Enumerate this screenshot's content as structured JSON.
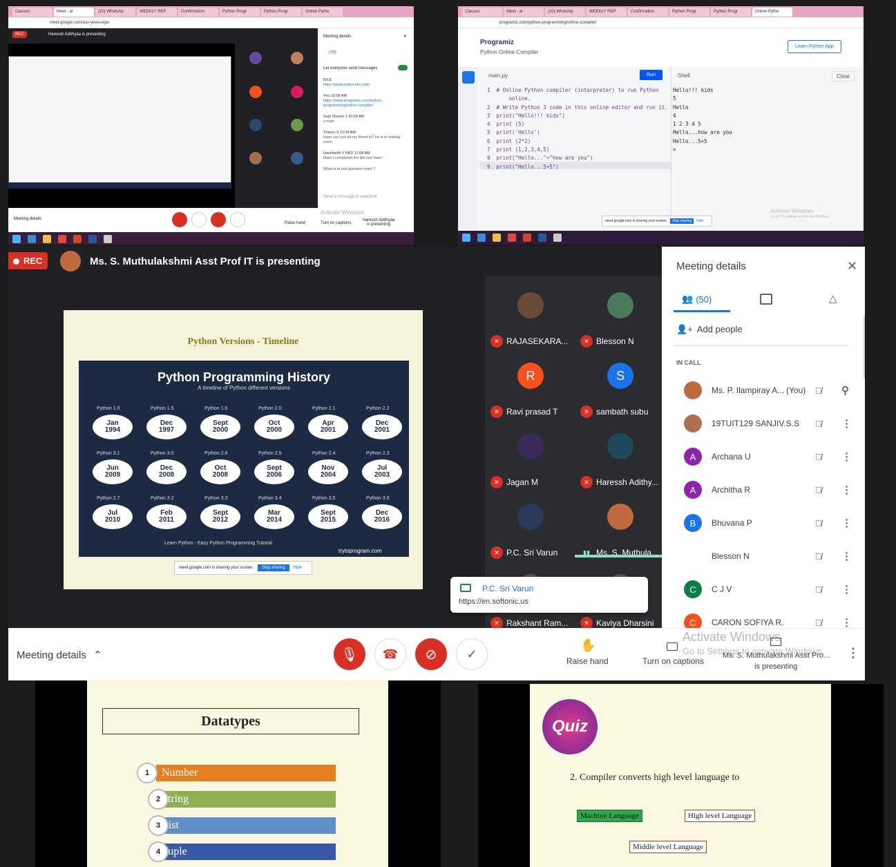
{
  "q1": {
    "tabs": [
      "Classes",
      "Meet - ai",
      "(20) WhatsAp",
      "WEEKLY REP",
      "Confirmation",
      "Python Progr",
      "Python Progr",
      "Online Pytho"
    ],
    "url": "meet.google.com/asv-yewo-egw",
    "rec": "REC",
    "presenting": "Haressh Adithyaa is presenting",
    "panel_title": "Meeting details",
    "people_count": "(49)",
    "toggle_text": "Let everyone send messages",
    "chat": [
      {
        "who": "IDLE",
        "text": "https://www.online-ide.com/"
      },
      {
        "who": "You 10:58 AM",
        "text": "https://www.programiz.com/python-programming/online-compiler/"
      },
      {
        "who": "Supi Sharon J 10:58 AM",
        "text": "s mam"
      },
      {
        "who": "Tharun S 11:04 AM",
        "text": "mam can you let my friend in? he is in waiting room"
      },
      {
        "who": "Harshanth V KKD 11:08 AM",
        "text": "Mam I completed the 8th one mam"
      },
      {
        "who": "",
        "text": "What is te last question mam ?"
      }
    ],
    "send_placeholder": "Send a message to everyone",
    "bottom_left": "Meeting details",
    "raise_hand": "Raise hand",
    "captions": "Turn on captions",
    "presenter": "Haressh Adithyaa is presenting",
    "watermark": "Activate Windows",
    "watermark2": "Go to settings to activate Windows"
  },
  "q2": {
    "tabs": [
      "Classes",
      "Meet - ai",
      "(20) WhatsAp",
      "WEEKLY REP",
      "Confirmation",
      "Python Progr",
      "Python Progr",
      "Online Pytho"
    ],
    "url": "programiz.com/python-programming/online-compiler/",
    "brand": "Programiz",
    "subtitle": "Python Online Compiler",
    "learn_button": "Learn Python App",
    "file": "main.py",
    "run": "Run",
    "shell": "Shell",
    "clear": "Clear",
    "code": [
      "1  # Online Python compiler (interpreter) to run Python",
      "       online.",
      "2  # Write Python 3 code in this online editor and run it.",
      "3  print(\"Hello!!! kids\")",
      "4  print (5)",
      "5  print('Hello')",
      "6  print (2*2)",
      "7  print (1,2,3,4,5)",
      "8  print(\"Hello...\"+\"how are you\")",
      "9  print(\"Hello...5+5\")"
    ],
    "output": [
      "Hello!!! kids",
      "5",
      "Hello",
      "4",
      "1 2 3 4 5",
      "Hello...how are you",
      "Hello...5+5",
      ">"
    ],
    "share_text": "meet.google.com is sharing your screen.",
    "stop_sharing": "Stop sharing",
    "hide": "Hide",
    "watermark": "Activate Windows",
    "watermark2": "Go to PC settings to activate Windows."
  },
  "main": {
    "rec": "REC",
    "presenting": "Ms. S. Muthulakshmi Asst Prof IT is presenting",
    "slide": {
      "heading": "Python Versions - Timeline",
      "title": "Python Programming History",
      "subtitle": "A timeline of Python different versions",
      "rows": [
        [
          [
            "Python 1.0",
            "Jan",
            "1994"
          ],
          [
            "Python 1.5",
            "Dec",
            "1997"
          ],
          [
            "Python 1.6",
            "Sept",
            "2000"
          ],
          [
            "Python 2.0",
            "Oct",
            "2000"
          ],
          [
            "Python 2.1",
            "Apr",
            "2001"
          ],
          [
            "Python 2.2",
            "Dec",
            "2001"
          ]
        ],
        [
          [
            "Python 3.1",
            "Jun",
            "2009"
          ],
          [
            "Python 3.0",
            "Dec",
            "2008"
          ],
          [
            "Python 2.6",
            "Oct",
            "2008"
          ],
          [
            "Python 2.5",
            "Sept",
            "2006"
          ],
          [
            "Python 2.4",
            "Nov",
            "2004"
          ],
          [
            "Python 2.3",
            "Jul",
            "2003"
          ]
        ],
        [
          [
            "Python 2.7",
            "Jul",
            "2010"
          ],
          [
            "Python 3.2",
            "Feb",
            "2011"
          ],
          [
            "Python 3.3",
            "Sept",
            "2012"
          ],
          [
            "Python 3.4",
            "Mar",
            "2014"
          ],
          [
            "Python 3.5",
            "Sept",
            "2015"
          ],
          [
            "Python 3.6",
            "Dec",
            "2016"
          ]
        ]
      ],
      "footer": "Learn Python - Easy Python Programming Tutorial",
      "site": "trytoprogram.com",
      "share_text": "meet.google.com is sharing your screen.",
      "stop_sharing": "Stop sharing",
      "hide": "Hide"
    },
    "tiles": [
      {
        "name": "RAJASEKARA...",
        "initial": "",
        "color": "#6b4a3a"
      },
      {
        "name": "Blesson N",
        "initial": "",
        "color": "#4a7a5a"
      },
      {
        "name": "Ravi prasad T",
        "initial": "R",
        "color": "#f4511e"
      },
      {
        "name": "sambath subu",
        "initial": "S",
        "color": "#1a73e8"
      },
      {
        "name": "Jagan M",
        "initial": "",
        "color": "#3a2a5a"
      },
      {
        "name": "Haressh Adithy...",
        "initial": "",
        "color": "#1e4a5a"
      },
      {
        "name": "P.C. Sri Varun",
        "initial": "",
        "color": "#2a3a5a"
      },
      {
        "name": "Ms. S. Muthula...",
        "initial": "",
        "color": "#c06a40"
      },
      {
        "name": "Rakshant Ram...",
        "initial": "",
        "color": "#555"
      },
      {
        "name": "Kaviya Dharsini",
        "initial": "",
        "color": "#555"
      }
    ],
    "chat_popup": {
      "who": "P.C. Sri Varun",
      "text": "https://en.softonic.us"
    },
    "panel": {
      "title": "Meeting details",
      "people_count": "(50)",
      "add_people": "Add people",
      "in_call": "IN CALL",
      "people": [
        {
          "name": "Ms. P. Ilampiray A...",
          "you": "(You)",
          "initial": "",
          "color": "#c06a40"
        },
        {
          "name": "19TUIT129 SANJIV.S.S",
          "you": "",
          "initial": "",
          "color": "#b07050"
        },
        {
          "name": "Archana U",
          "you": "",
          "initial": "A",
          "color": "#8e24aa"
        },
        {
          "name": "Architha R",
          "you": "",
          "initial": "A",
          "color": "#8e24aa"
        },
        {
          "name": "Bhuvana P",
          "you": "",
          "initial": "B",
          "color": "#1a73e8"
        },
        {
          "name": "Blesson N",
          "you": "",
          "initial": "",
          "color": "transparent"
        },
        {
          "name": "C J V",
          "you": "",
          "initial": "C",
          "color": "#0b8043"
        },
        {
          "name": "CARON SOFIYA R.",
          "you": "",
          "initial": "C",
          "color": "#f4511e"
        }
      ]
    },
    "bottom": {
      "meeting_details": "Meeting details",
      "raise_hand": "Raise hand",
      "captions": "Turn on captions",
      "presenter": "Ms. S. Muthulakshmi Asst Pro...",
      "presenter2": "is presenting",
      "watermark": "Activate Windows",
      "watermark2": "Go to Settings to activate Windows."
    }
  },
  "q3": {
    "title": "Datatypes",
    "items": [
      "Number",
      "String",
      "List",
      "Tuple"
    ],
    "nums": [
      "1",
      "2",
      "3",
      "4"
    ],
    "colors": [
      "#e67e22",
      "#8fb050",
      "#5d8fc8",
      "#3a5aa8"
    ]
  },
  "q4": {
    "logo": "Quiz",
    "question": "2. Compiler converts high level language to",
    "options": [
      "Machine Language",
      "High level Language",
      "Middle level Language"
    ]
  }
}
